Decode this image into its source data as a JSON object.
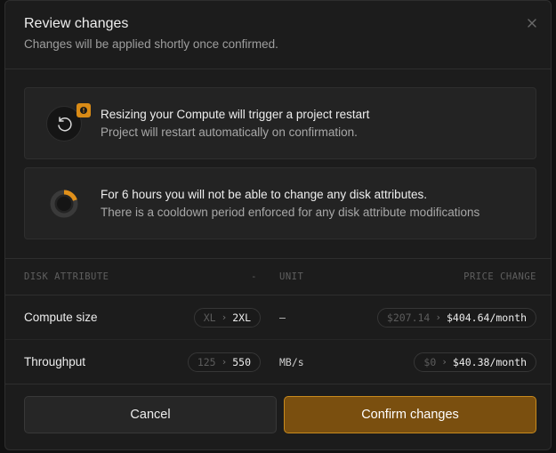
{
  "modal": {
    "title": "Review changes",
    "subtitle": "Changes will be applied shortly once confirmed."
  },
  "alerts": [
    {
      "icon": "restart-icon",
      "title": "Resizing your Compute will trigger a project restart",
      "description": "Project will restart automatically on confirmation."
    },
    {
      "icon": "cooldown-icon",
      "title": "For 6 hours you will not be able to change any disk attributes.",
      "description": "There is a cooldown period enforced for any disk attribute modifications"
    }
  ],
  "table": {
    "headers": {
      "attribute": "DISK ATTRIBUTE",
      "dash": "-",
      "unit": "UNIT",
      "price": "PRICE CHANGE"
    },
    "rows": [
      {
        "attribute": "Compute size",
        "from": "XL",
        "to": "2XL",
        "unit": "–",
        "price_from": "$207.14",
        "price_to": "$404.64/month"
      },
      {
        "attribute": "Throughput",
        "from": "125",
        "to": "550",
        "unit": "MB/s",
        "price_from": "$0",
        "price_to": "$40.38/month"
      }
    ]
  },
  "buttons": {
    "cancel": "Cancel",
    "confirm": "Confirm changes"
  },
  "colors": {
    "accent": "#c88a1d",
    "confirm_bg": "#7a4f0f",
    "warning": "#d98b16"
  }
}
